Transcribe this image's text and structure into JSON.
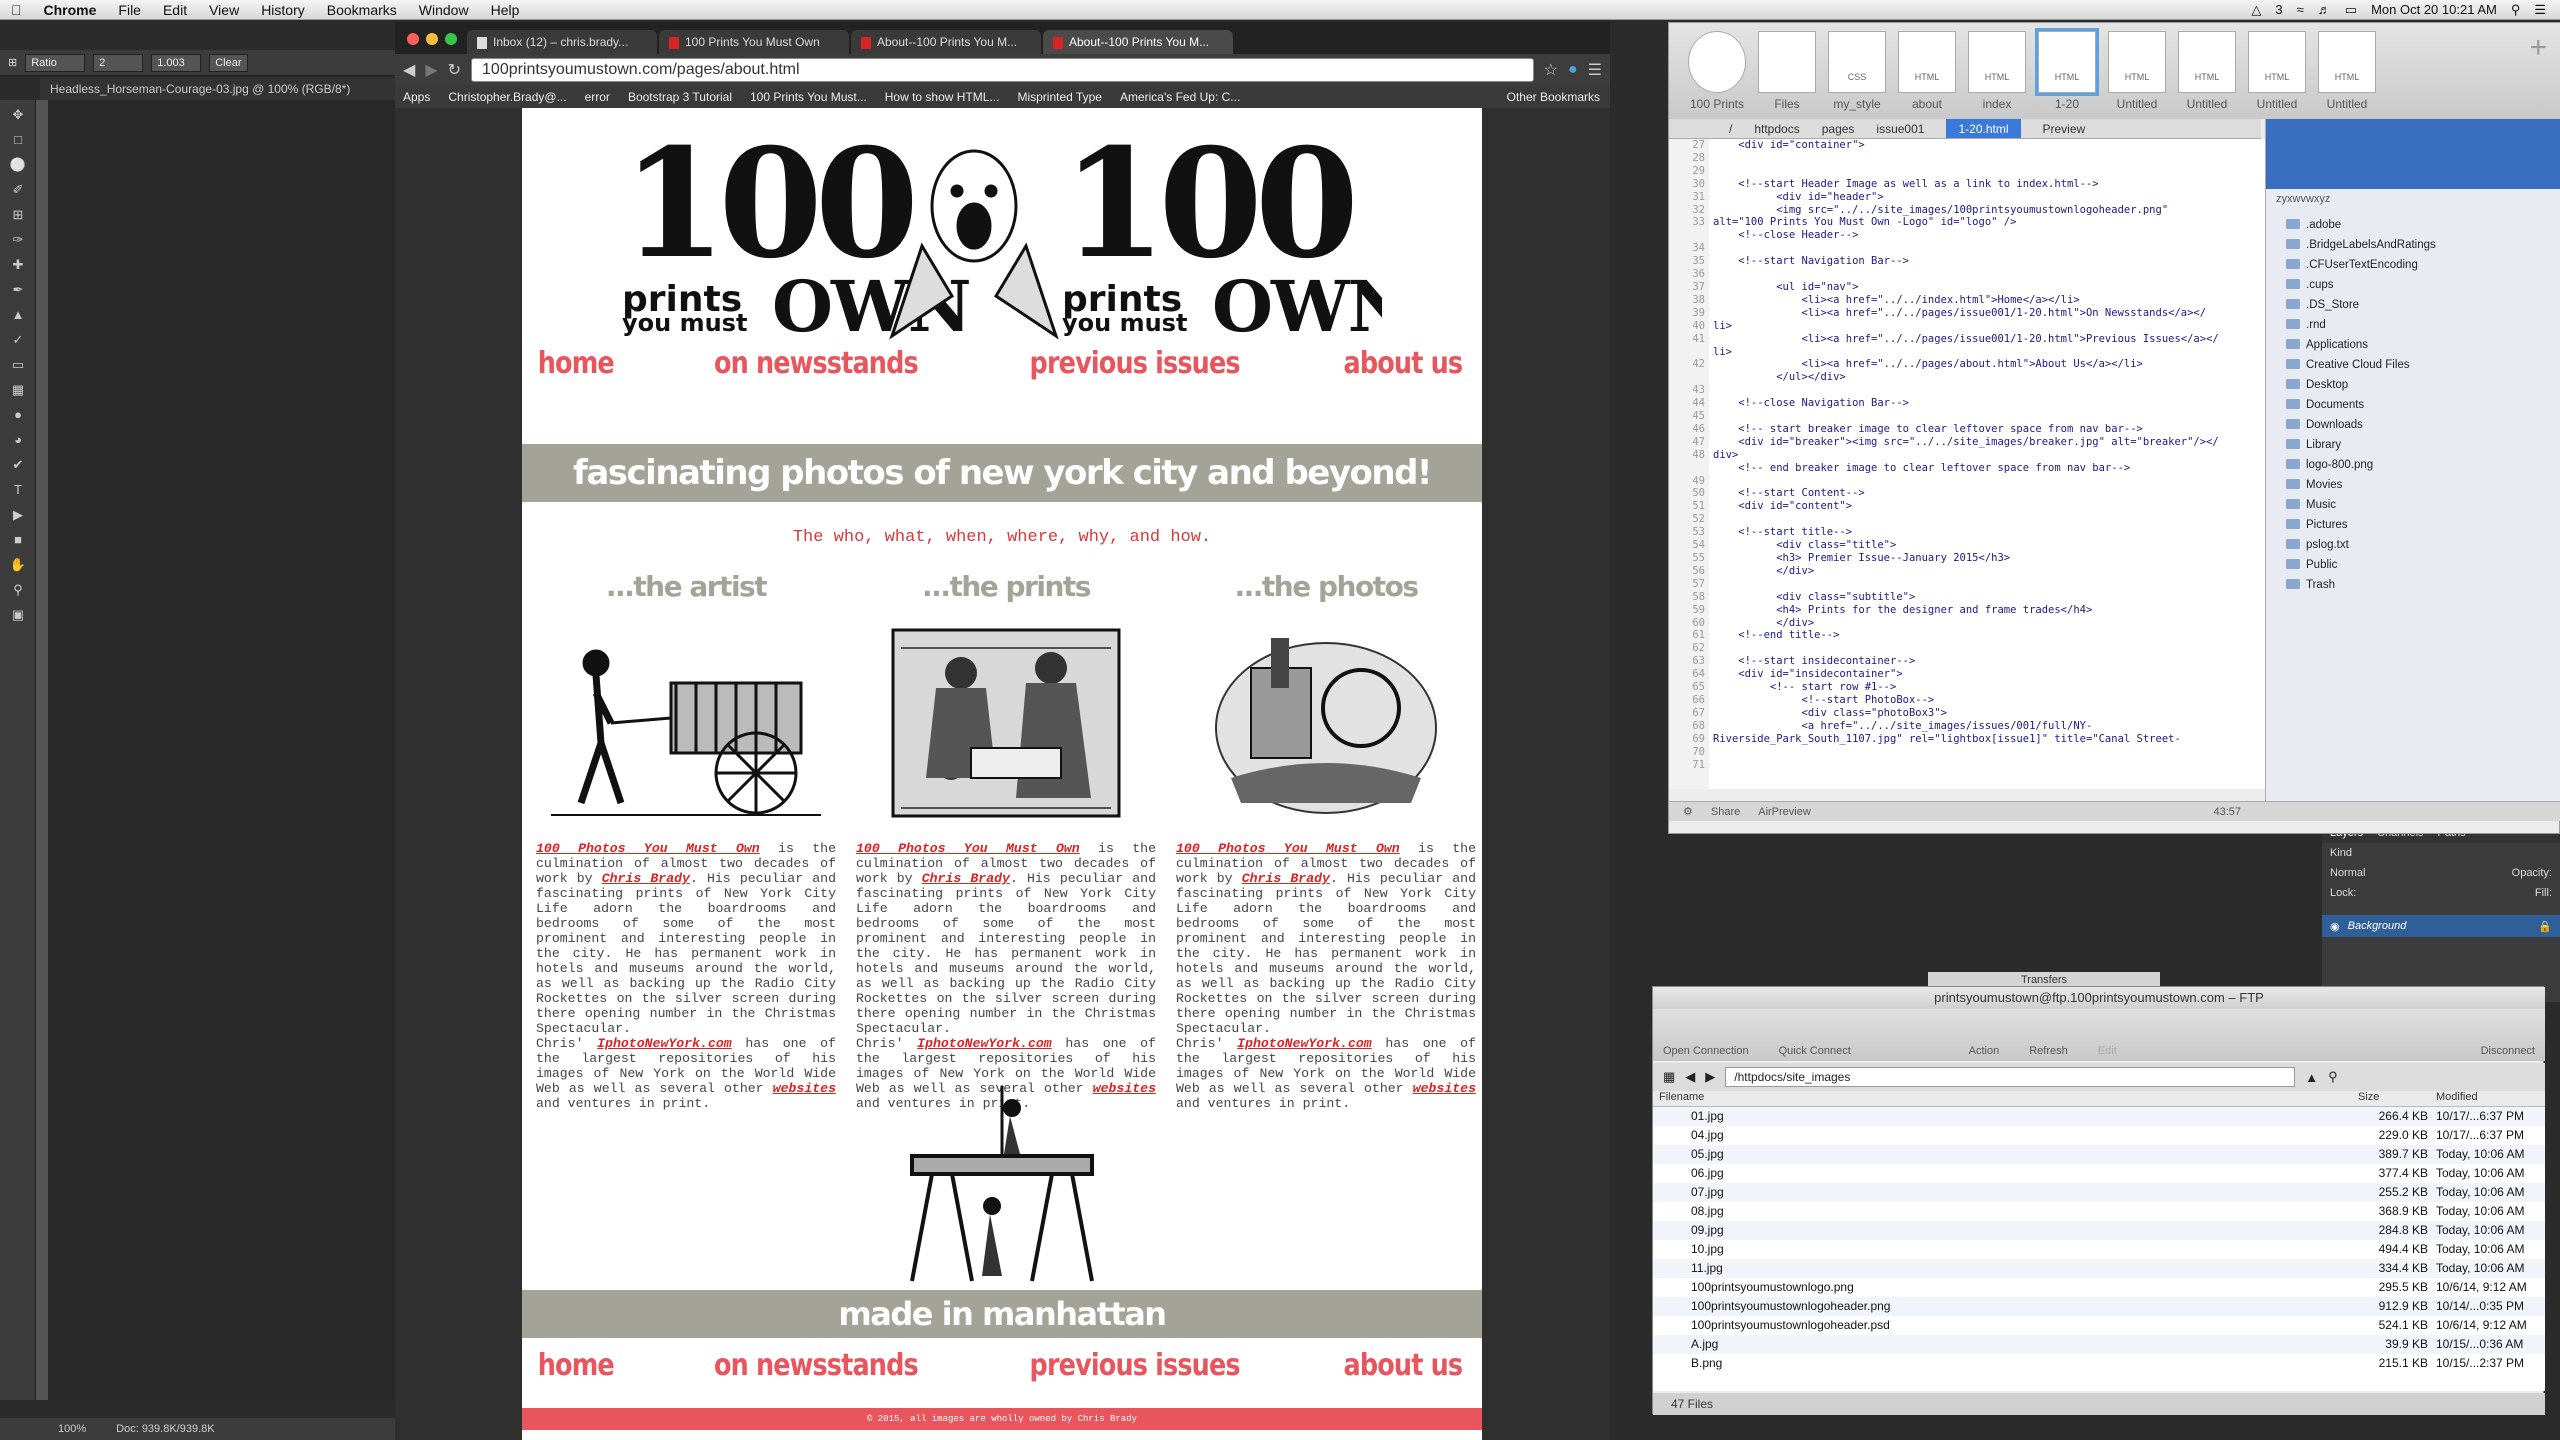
{
  "menubar": {
    "app": "Chrome",
    "items": [
      "File",
      "Edit",
      "View",
      "History",
      "Bookmarks",
      "Window",
      "Help"
    ],
    "clock": "Mon Oct 20  10:21 AM",
    "badge": "3"
  },
  "photoshop": {
    "tool_ratio": "Ratio",
    "field_a": "2",
    "field_b": "1.003",
    "clear": "Clear",
    "doc_tab": "Headless_Horseman-Courage-03.jpg @ 100% (RGB/8*)",
    "zoom": "100%",
    "doc_size": "Doc: 939.8K/939.8K",
    "layers_tabs": [
      "Layers",
      "Channels",
      "Paths"
    ],
    "kind": "Kind",
    "blend": "Normal",
    "opacity": "Opacity:",
    "lock": "Lock:",
    "fill": "Fill:",
    "background_layer": "Background"
  },
  "chrome": {
    "tabs": [
      "Inbox (12) – chris.brady...",
      "100 Prints You Must Own",
      "About--100 Prints You M...",
      "About--100 Prints You M..."
    ],
    "url": "100printsyoumustown.com/pages/about.html",
    "bookmarks": [
      "Apps",
      "Christopher.Brady@...",
      "error",
      "Bootstrap 3 Tutorial",
      "100 Prints You Must...",
      "How to show HTML...",
      "Misprinted Type",
      "America's Fed Up: C...",
      "Other Bookmarks"
    ]
  },
  "site": {
    "nav": [
      "home",
      "on newsstands",
      "previous issues",
      "about us"
    ],
    "tagline": "fascinating photos of new york city and beyond!",
    "subtitle": "The who, what, when, where, why, and how.",
    "columns": [
      {
        "heading": "...the artist"
      },
      {
        "heading": "...the prints"
      },
      {
        "heading": "...the photos"
      }
    ],
    "bio_pre": "100 Photos You Must Own",
    "bio_a": " is the culmination of almost two decades of work by ",
    "author": "Chris Brady",
    "bio_b": ". His peculiar and fascinating prints of New York City Life adorn the boardrooms and bedrooms of some of the most prominent and interesting people in the city. He has permanent work in hotels and museums around the world, as well as backing up the Radio City Rockettes on the silver screen during there opening number in the Christmas Spectacular.",
    "bio_c": "Chris' ",
    "site_link": "IphotoNewYork.com",
    "bio_d": " has one of the largest repositories of his images of New York on the World Wide Web as well as several other ",
    "websites": "websites",
    "bio_e": " and ventures in print.",
    "made": "made in manhattan",
    "footer": "© 2015, all images are wholly owned by Chris Brady"
  },
  "coda": {
    "tabs": [
      "100 Prints",
      "Files",
      "my_style",
      "about",
      "index",
      "1-20",
      "Untitled",
      "Untitled",
      "Untitled",
      "Untitled"
    ],
    "tab_types": [
      "",
      "",
      "CSS",
      "HTML",
      "HTML",
      "HTML",
      "HTML",
      "HTML",
      "HTML",
      "HTML"
    ],
    "path": [
      "/",
      "httpdocs",
      "pages",
      "issue001",
      "1-20.html",
      "Preview"
    ],
    "line_numbers": "27\n28\n29\n30\n31\n32\n33\n\n34\n35\n36\n37\n38\n39\n40\n41\n\n42\n\n43\n44\n45\n46\n47\n48\n\n49\n50\n51\n52\n53\n54\n55\n56\n57\n58\n59\n60\n61\n62\n63\n64\n65\n66\n67\n68\n69\n70\n71",
    "code": "    <div id=\"container\">\n\n\n    <!--start Header Image as well as a link to index.html-->\n          <div id=\"header\">\n          <img src=\"../../site_images/100printsyoumustownlogoheader.png\"\nalt=\"100 Prints You Must Own -Logo\" id=\"logo\" />\n    <!--close Header-->\n\n    <!--start Navigation Bar-->\n\n          <ul id=\"nav\">\n              <li><a href=\"../../index.html\">Home</a></li>\n              <li><a href=\"../../pages/issue001/1-20.html\">On Newsstands</a></\nli>\n              <li><a href=\"../../pages/issue001/1-20.html\">Previous Issues</a></\nli>\n              <li><a href=\"../../pages/about.html\">About Us</a></li>\n          </ul></div>\n\n    <!--close Navigation Bar-->\n\n    <!-- start breaker image to clear leftover space from nav bar-->\n    <div id=\"breaker\"><img src=\"../../site_images/breaker.jpg\" alt=\"breaker\"/></\ndiv>\n    <!-- end breaker image to clear leftover space from nav bar-->\n\n    <!--start Content-->\n    <div id=\"content\">\n\n    <!--start title-->\n          <div class=\"title\">\n          <h3> Premier Issue--January 2015</h3>\n          </div>\n\n          <div class=\"subtitle\">\n          <h4> Prints for the designer and frame trades</h4>\n          </div>\n    <!--end title-->\n\n    <!--start insidecontainer-->\n    <div id=\"insidecontainer\">\n         <!-- start row #1-->\n              <!--start PhotoBox-->\n              <div class=\"photoBox3\">\n              <a href=\"../../site_images/issues/001/full/NY-\nRiverside_Park_South_1107.jpg\" rel=\"lightbox[issue1]\" title=\"Canal Street-",
    "sidebar_search": "zyxwvwxyz",
    "files": [
      ".adobe",
      ".BridgeLabelsAndRatings",
      ".CFUserTextEncoding",
      ".cups",
      ".DS_Store",
      ".rnd",
      "Applications",
      "Creative Cloud Files",
      "Desktop",
      "Documents",
      "Downloads",
      "Library",
      "logo-800.png",
      "Movies",
      "Music",
      "Pictures",
      "pslog.txt",
      "Public",
      "Trash"
    ],
    "status": [
      "Share",
      "AirPreview",
      "43:57"
    ]
  },
  "ftp": {
    "title": "printsyoumustown@ftp.100printsyoumustown.com – FTP",
    "transfers": "Transfers",
    "tools": [
      "Open Connection",
      "Quick Connect",
      "Action",
      "Refresh",
      "Edit",
      "Disconnect"
    ],
    "path": "/httpdocs/site_images",
    "headers": [
      "Filename",
      "Size",
      "Modified"
    ],
    "files": [
      [
        "01.jpg",
        "266.4 KB",
        "10/17/...6:37 PM"
      ],
      [
        "04.jpg",
        "229.0 KB",
        "10/17/...6:37 PM"
      ],
      [
        "05.jpg",
        "389.7 KB",
        "Today, 10:06 AM"
      ],
      [
        "06.jpg",
        "377.4 KB",
        "Today, 10:06 AM"
      ],
      [
        "07.jpg",
        "255.2 KB",
        "Today, 10:06 AM"
      ],
      [
        "08.jpg",
        "368.9 KB",
        "Today, 10:06 AM"
      ],
      [
        "09.jpg",
        "284.8 KB",
        "Today, 10:06 AM"
      ],
      [
        "10.jpg",
        "494.4 KB",
        "Today, 10:06 AM"
      ],
      [
        "11.jpg",
        "334.4 KB",
        "Today, 10:06 AM"
      ],
      [
        "100printsyoumustownlogo.png",
        "295.5 KB",
        "10/6/14, 9:12 AM"
      ],
      [
        "100printsyoumustownlogoheader.png",
        "912.9 KB",
        "10/14/...0:35 PM"
      ],
      [
        "100printsyoumustownlogoheader.psd",
        "524.1 KB",
        "10/6/14, 9:12 AM"
      ],
      [
        "A.jpg",
        "39.9 KB",
        "10/15/...0:36 AM"
      ],
      [
        "B.png",
        "215.1 KB",
        "10/15/...2:37 PM"
      ]
    ],
    "count": "47 Files"
  }
}
